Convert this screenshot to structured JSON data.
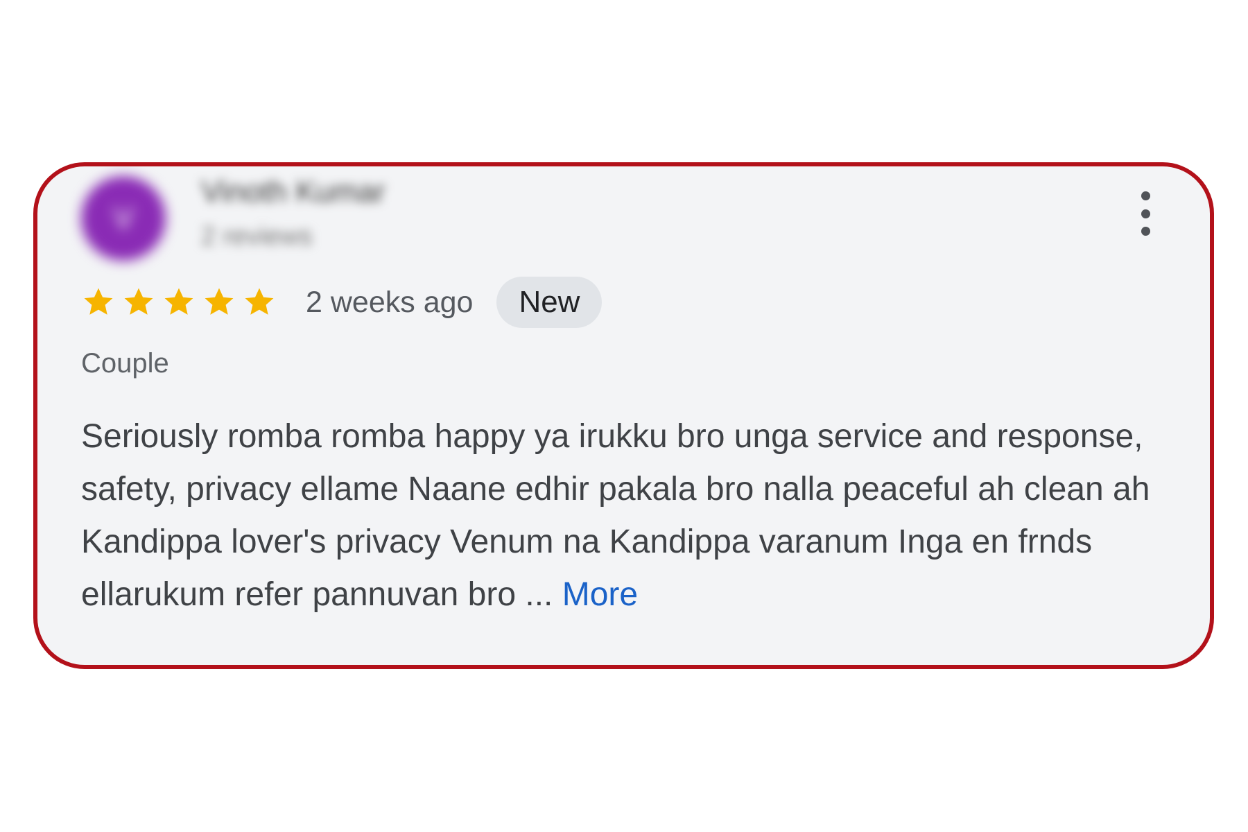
{
  "review": {
    "reviewer": {
      "initial": "V",
      "name": "Vinoth Kumar",
      "meta": "2 reviews",
      "avatar_color": "#8a2bb5"
    },
    "rating": 5,
    "rating_max": 5,
    "time_ago": "2 weeks ago",
    "badge": "New",
    "trip_type": "Couple",
    "text": "Seriously romba romba happy ya irukku bro unga service and response, safety, privacy ellame Naane edhir pakala bro nalla peaceful ah clean ah Kandippa lover's privacy Venum na Kandippa varanum Inga en frnds ellarukum refer pannuvan bro",
    "ellipsis": " ... ",
    "more_label": "More",
    "menu_icon": "more-vert-icon"
  },
  "colors": {
    "highlight_border": "#b3111a",
    "star": "#f6b400",
    "link": "#1a62c8",
    "card_background": "#f3f4f6"
  }
}
